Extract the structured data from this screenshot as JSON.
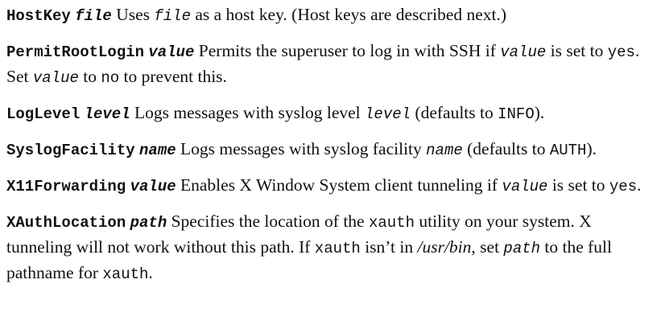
{
  "entries": [
    {
      "keyword": "HostKey",
      "arg": "file",
      "parts": [
        {
          "t": "Uses "
        },
        {
          "c": "file"
        },
        {
          "t": " as a host key. (Host keys are described next.)"
        }
      ]
    },
    {
      "keyword": "PermitRootLogin",
      "arg": "value",
      "parts": [
        {
          "t": "Permits the superuser to log in with SSH if "
        },
        {
          "c": "value"
        },
        {
          "t": " is set to "
        },
        {
          "m": "yes"
        },
        {
          "t": ". Set "
        },
        {
          "c": "value"
        },
        {
          "t": " to "
        },
        {
          "m": "no"
        },
        {
          "t": " to prevent this."
        }
      ]
    },
    {
      "keyword": "LogLevel",
      "arg": "level",
      "parts": [
        {
          "t": "Logs messages with syslog level "
        },
        {
          "c": "level"
        },
        {
          "t": " (defaults to "
        },
        {
          "m": "INFO"
        },
        {
          "t": ")."
        }
      ]
    },
    {
      "keyword": "SyslogFacility",
      "arg": "name",
      "parts": [
        {
          "t": "Logs messages with syslog facility "
        },
        {
          "c": "name"
        },
        {
          "t": " (defaults to "
        },
        {
          "m": "AUTH"
        },
        {
          "t": ")."
        }
      ]
    },
    {
      "keyword": "X11Forwarding",
      "arg": "value",
      "parts": [
        {
          "t": "Enables X Window System client tunneling if "
        },
        {
          "c": "value"
        },
        {
          "t": " is set to "
        },
        {
          "m": "yes"
        },
        {
          "t": "."
        }
      ]
    },
    {
      "keyword": "XAuthLocation",
      "arg": "path",
      "parts": [
        {
          "t": "Specifies the location of the "
        },
        {
          "m": "xauth"
        },
        {
          "t": " utility on your system. X tunneling will not work without this path. If "
        },
        {
          "m": "xauth"
        },
        {
          "t": " isn’t in "
        },
        {
          "i": "/usr/bin"
        },
        {
          "t": ", set "
        },
        {
          "c": "path"
        },
        {
          "t": " to the full pathname for "
        },
        {
          "m": "xauth"
        },
        {
          "t": "."
        }
      ]
    }
  ]
}
